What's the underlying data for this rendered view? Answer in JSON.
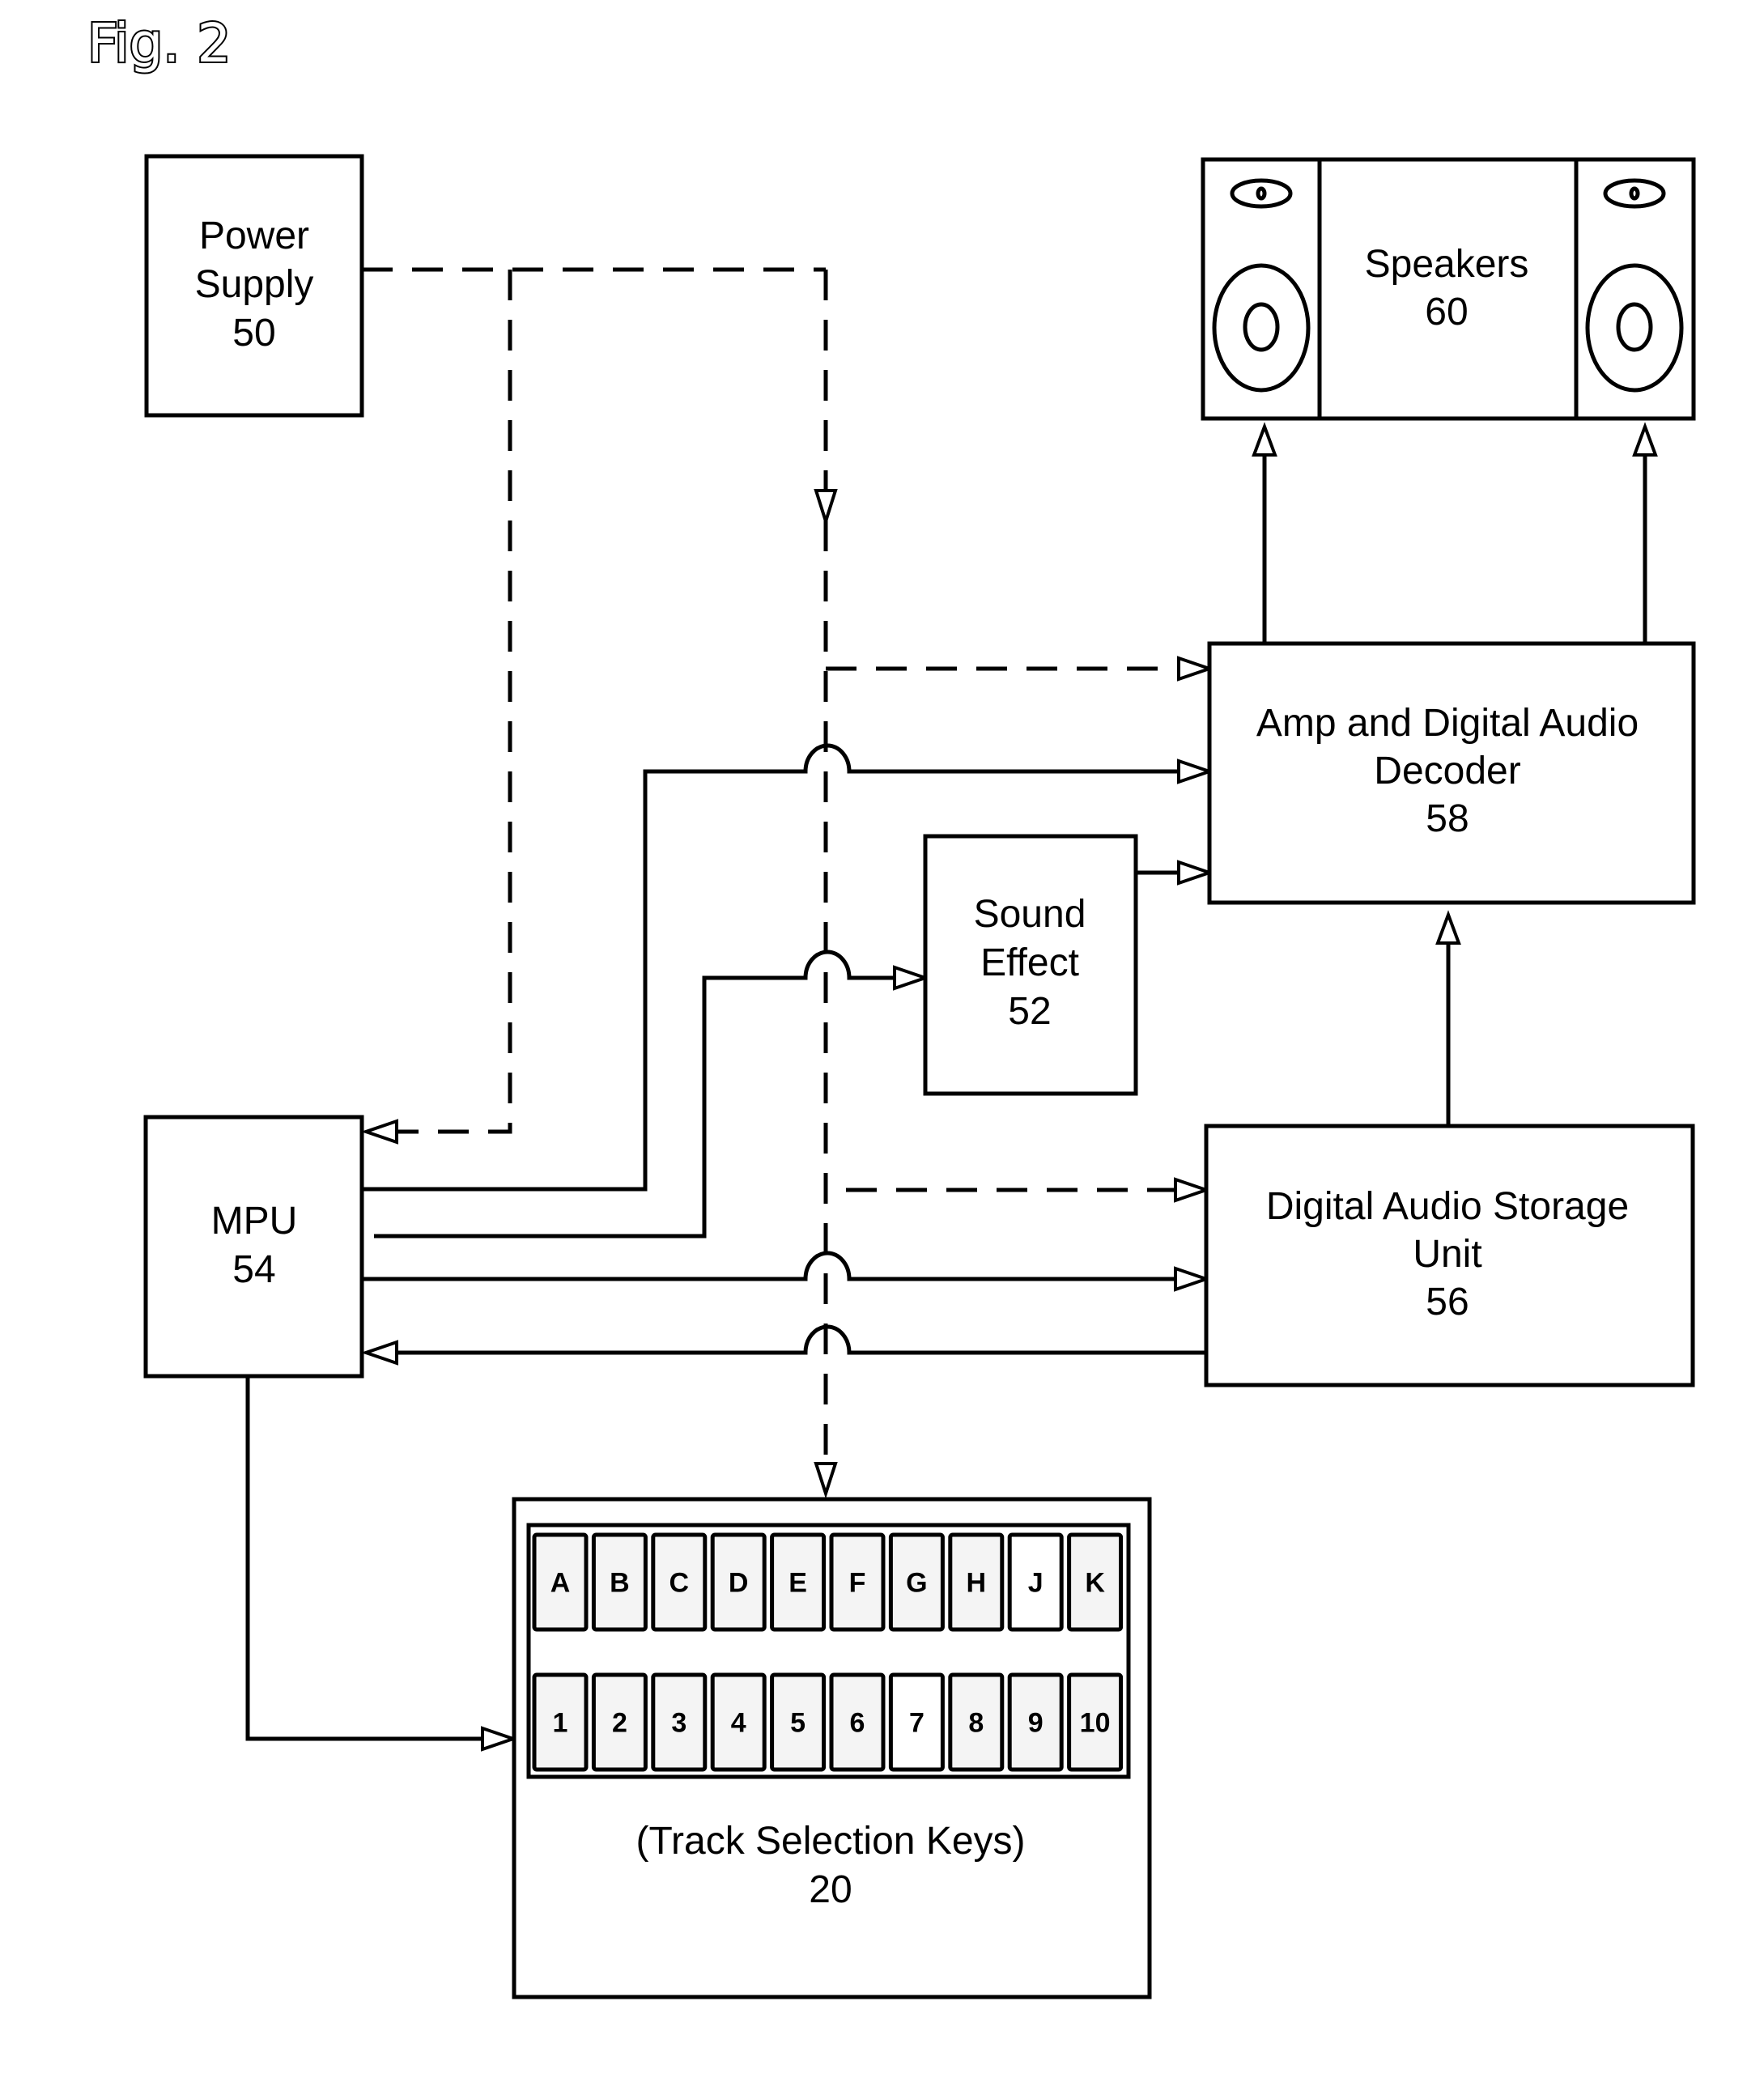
{
  "figure": {
    "label": "Fig. 2"
  },
  "blocks": {
    "power_supply": {
      "lines": [
        "Power",
        "Supply",
        "50"
      ]
    },
    "speakers": {
      "lines": [
        "Speakers",
        "60"
      ]
    },
    "amp_decoder": {
      "lines": [
        "Amp and Digital Audio",
        "Decoder",
        "58"
      ]
    },
    "sound_effect": {
      "lines": [
        "Sound",
        "Effect",
        "52"
      ]
    },
    "mpu": {
      "lines": [
        "MPU",
        "54"
      ]
    },
    "storage": {
      "lines": [
        "Digital Audio Storage",
        "Unit",
        "56"
      ]
    },
    "keypad": {
      "lines": [
        "(Track Selection Keys)",
        "20"
      ],
      "letter_keys": [
        "A",
        "B",
        "C",
        "D",
        "E",
        "F",
        "G",
        "H",
        "J",
        "K"
      ],
      "number_keys": [
        "1",
        "2",
        "3",
        "4",
        "5",
        "6",
        "7",
        "8",
        "9",
        "10"
      ]
    }
  },
  "connections": [
    {
      "from": "power_supply",
      "to": "mpu",
      "style": "dashed"
    },
    {
      "from": "power_supply",
      "to": "amp_decoder",
      "style": "dashed"
    },
    {
      "from": "power_supply",
      "to": "storage",
      "style": "dashed"
    },
    {
      "from": "power_supply",
      "to": "keypad",
      "style": "dashed"
    },
    {
      "from": "mpu",
      "to": "amp_decoder",
      "style": "solid"
    },
    {
      "from": "mpu",
      "to": "sound_effect",
      "style": "solid"
    },
    {
      "from": "mpu",
      "to": "storage",
      "style": "solid"
    },
    {
      "from": "storage",
      "to": "mpu",
      "style": "solid"
    },
    {
      "from": "mpu",
      "to": "keypad",
      "style": "solid"
    },
    {
      "from": "sound_effect",
      "to": "amp_decoder",
      "style": "solid"
    },
    {
      "from": "storage",
      "to": "amp_decoder",
      "style": "solid"
    },
    {
      "from": "amp_decoder",
      "to": "speakers",
      "style": "solid",
      "count": 2
    }
  ]
}
